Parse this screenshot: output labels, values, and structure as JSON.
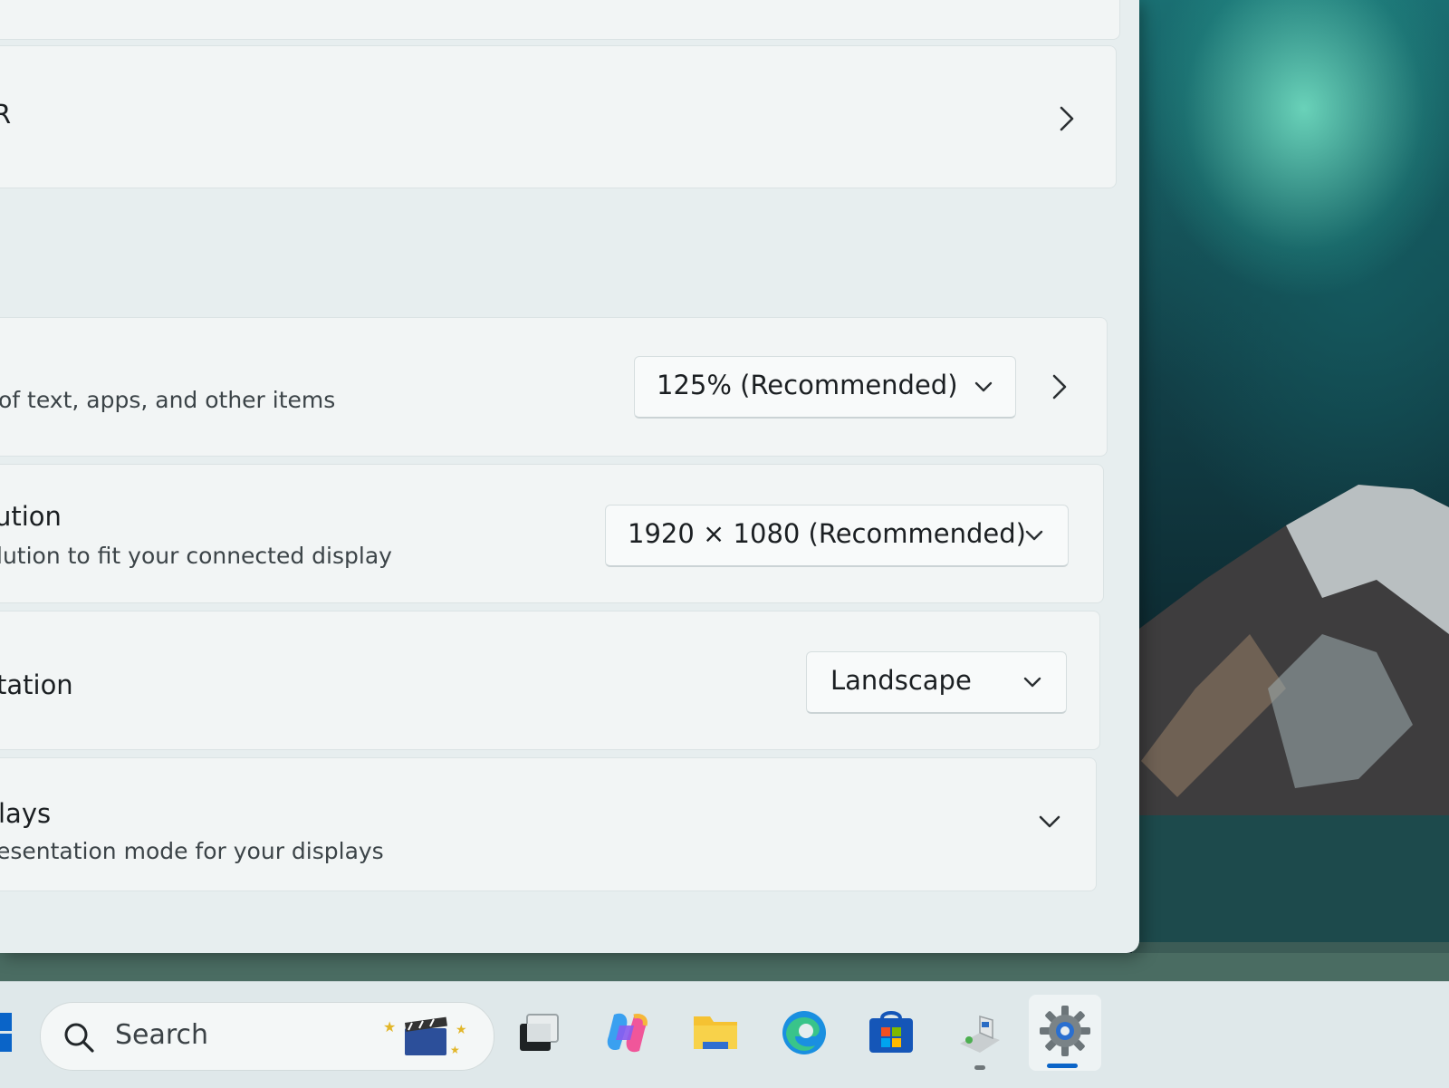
{
  "window": {
    "top_row_partial_label": "R",
    "scale": {
      "description": "of text, apps, and other items",
      "value": "125% (Recommended)"
    },
    "resolution": {
      "title": "ution",
      "description": "lution to fit your connected display",
      "value": "1920 × 1080 (Recommended)"
    },
    "orientation": {
      "title": "tation",
      "value": "Landscape"
    },
    "multiple_displays": {
      "title": "lays",
      "description": "esentation mode for your displays"
    }
  },
  "taskbar": {
    "search_label": "Search",
    "icons": [
      "start-icon",
      "search-icon",
      "widgets-icon",
      "task-view-icon",
      "copilot-icon",
      "file-explorer-icon",
      "edge-icon",
      "store-icon",
      "app-icon",
      "settings-icon"
    ]
  },
  "colors": {
    "accent": "#0a64c8",
    "window_bg": "#e7eeef",
    "card_bg": "#f2f5f5"
  }
}
